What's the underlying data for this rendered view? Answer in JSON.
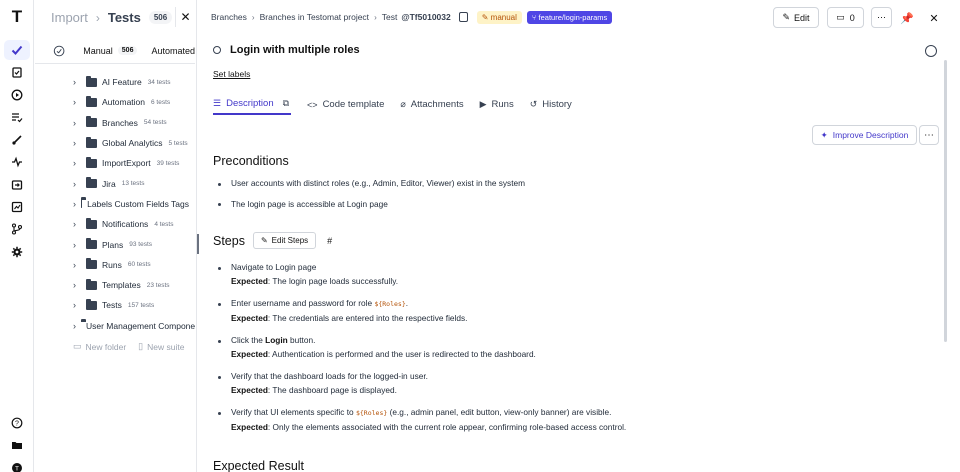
{
  "left_panel": {
    "breadcrumb_import": "Import",
    "breadcrumb_tests": "Tests",
    "tests_count": "506",
    "tab_manual": "Manual",
    "tab_manual_count": "506",
    "tab_automated": "Automated",
    "tree": [
      {
        "name": "AI Feature",
        "count": "34 tests"
      },
      {
        "name": "Automation",
        "count": "6 tests"
      },
      {
        "name": "Branches",
        "count": "54 tests"
      },
      {
        "name": "Global Analytics",
        "count": "5 tests"
      },
      {
        "name": "ImportExport",
        "count": "39 tests"
      },
      {
        "name": "Jira",
        "count": "13 tests"
      },
      {
        "name": "Labels Custom Fields Tags",
        "count": ""
      },
      {
        "name": "Notifications",
        "count": "4 tests"
      },
      {
        "name": "Plans",
        "count": "93 tests"
      },
      {
        "name": "Runs",
        "count": "60 tests"
      },
      {
        "name": "Templates",
        "count": "23 tests"
      },
      {
        "name": "Tests",
        "count": "157 tests"
      },
      {
        "name": "User Management Components",
        "count": ""
      }
    ],
    "new_folder": "New folder",
    "new_suite": "New suite"
  },
  "topbar": {
    "crumb1": "Branches",
    "crumb2": "Branches in Testomat project",
    "crumb3_prefix": "Test",
    "test_id": "@Tf5010032",
    "tag_manual": "manual",
    "tag_branch": "feature/login-params",
    "edit_label": "Edit",
    "comments_count": "0"
  },
  "test": {
    "title": "Login with multiple roles",
    "set_labels": "Set labels"
  },
  "tabs": [
    {
      "label": "Description",
      "icon": "list-icon"
    },
    {
      "label": "Code template",
      "icon": "code-icon"
    },
    {
      "label": "Attachments",
      "icon": "paperclip-icon"
    },
    {
      "label": "Runs",
      "icon": "play-icon"
    },
    {
      "label": "History",
      "icon": "history-icon"
    }
  ],
  "improve_label": "Improve Description",
  "preconditions": {
    "heading": "Preconditions",
    "items": [
      "User accounts with distinct roles (e.g., Admin, Editor, Viewer) exist in the system",
      "The login page is accessible at Login page"
    ]
  },
  "steps": {
    "heading": "Steps",
    "edit_label": "Edit Steps",
    "hash": "#",
    "expected_label": "Expected",
    "items": [
      {
        "pre": "Navigate to Login page",
        "code": "",
        "post": "",
        "bold": "",
        "expected": "The login page loads successfully."
      },
      {
        "pre": "Enter username and password for role ",
        "code": "${Roles}",
        "post": ".",
        "bold": "",
        "expected": "The credentials are entered into the respective fields."
      },
      {
        "pre": "Click the ",
        "code": "",
        "post": " button.",
        "bold": "Login",
        "expected": "Authentication is performed and the user is redirected to the dashboard."
      },
      {
        "pre": "Verify that the dashboard loads for the logged-in user.",
        "code": "",
        "post": "",
        "bold": "",
        "expected": "The dashboard page is displayed."
      },
      {
        "pre": "Verify that UI elements specific to ",
        "code": "${Roles}",
        "post": " (e.g., admin panel, edit button, view-only banner) are visible.",
        "bold": "",
        "expected": "Only the elements associated with the current role appear, confirming role-based access control."
      }
    ]
  },
  "expected_result_heading": "Expected Result",
  "colors": {
    "accent": "#4338ca",
    "branch_tag": "#4f46e5",
    "manual_tag_bg": "#fef3c7",
    "manual_tag_text": "#b45309"
  }
}
